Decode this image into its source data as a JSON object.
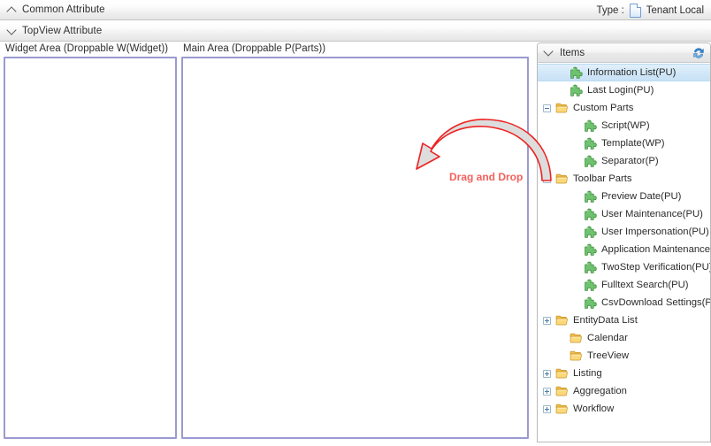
{
  "header": {
    "common_attribute": {
      "label": "Common Attribute",
      "chevron": "chevron-up-icon",
      "expanded": true
    },
    "topview_attribute": {
      "label": "TopView Attribute",
      "chevron": "chevron-down-icon",
      "expanded": false
    },
    "type": {
      "label": "Type :",
      "icon": "document-icon",
      "value": "Tenant Local"
    }
  },
  "zones": [
    {
      "id": "widget",
      "label": "Widget Area (Droppable W(Widget))",
      "content": ""
    },
    {
      "id": "main",
      "label": "Main Area (Droppable P(Parts))",
      "content": ""
    }
  ],
  "items_panel": {
    "title": "Items",
    "chevron": "chevron-down-icon",
    "refresh_icon": "refresh-icon",
    "tree": [
      {
        "label": "Information List(PU)",
        "icon": "puzzle-icon",
        "indent": 1,
        "expander": "none",
        "selected": true
      },
      {
        "label": "Last Login(PU)",
        "icon": "puzzle-icon",
        "indent": 1,
        "expander": "none",
        "selected": false
      },
      {
        "label": "Custom Parts",
        "icon": "folder-icon",
        "indent": 0,
        "expander": "minus",
        "selected": false
      },
      {
        "label": "Script(WP)",
        "icon": "puzzle-icon",
        "indent": 2,
        "expander": "none",
        "selected": false
      },
      {
        "label": "Template(WP)",
        "icon": "puzzle-icon",
        "indent": 2,
        "expander": "none",
        "selected": false
      },
      {
        "label": "Separator(P)",
        "icon": "puzzle-icon",
        "indent": 2,
        "expander": "none",
        "selected": false
      },
      {
        "label": "Toolbar Parts",
        "icon": "folder-icon",
        "indent": 0,
        "expander": "minus",
        "selected": false
      },
      {
        "label": "Preview Date(PU)",
        "icon": "puzzle-icon",
        "indent": 2,
        "expander": "none",
        "selected": false
      },
      {
        "label": "User Maintenance(PU)",
        "icon": "puzzle-icon",
        "indent": 2,
        "expander": "none",
        "selected": false
      },
      {
        "label": "User Impersonation(PU)",
        "icon": "puzzle-icon",
        "indent": 2,
        "expander": "none",
        "selected": false
      },
      {
        "label": "Application Maintenance(PU)",
        "icon": "puzzle-icon",
        "indent": 2,
        "expander": "none",
        "selected": false
      },
      {
        "label": "TwoStep Verification(PU)",
        "icon": "puzzle-icon",
        "indent": 2,
        "expander": "none",
        "selected": false
      },
      {
        "label": "Fulltext Search(PU)",
        "icon": "puzzle-icon",
        "indent": 2,
        "expander": "none",
        "selected": false
      },
      {
        "label": "CsvDownload Settings(PU)",
        "icon": "puzzle-icon",
        "indent": 2,
        "expander": "none",
        "selected": false
      },
      {
        "label": "EntityData List",
        "icon": "folder-icon",
        "indent": 0,
        "expander": "plus",
        "selected": false
      },
      {
        "label": "Calendar",
        "icon": "folder-icon",
        "indent": 1,
        "expander": "none",
        "selected": false
      },
      {
        "label": "TreeView",
        "icon": "folder-icon",
        "indent": 1,
        "expander": "none",
        "selected": false
      },
      {
        "label": "Listing",
        "icon": "folder-icon",
        "indent": 0,
        "expander": "plus",
        "selected": false
      },
      {
        "label": "Aggregation",
        "icon": "folder-icon",
        "indent": 0,
        "expander": "plus",
        "selected": false
      },
      {
        "label": "Workflow",
        "icon": "folder-icon",
        "indent": 0,
        "expander": "plus",
        "selected": false
      }
    ]
  },
  "annotation": {
    "text": "Drag and Drop",
    "text_color": "#f4615c",
    "arrow_fill": "#dcdcdc",
    "arrow_stroke": "#ee2222"
  }
}
